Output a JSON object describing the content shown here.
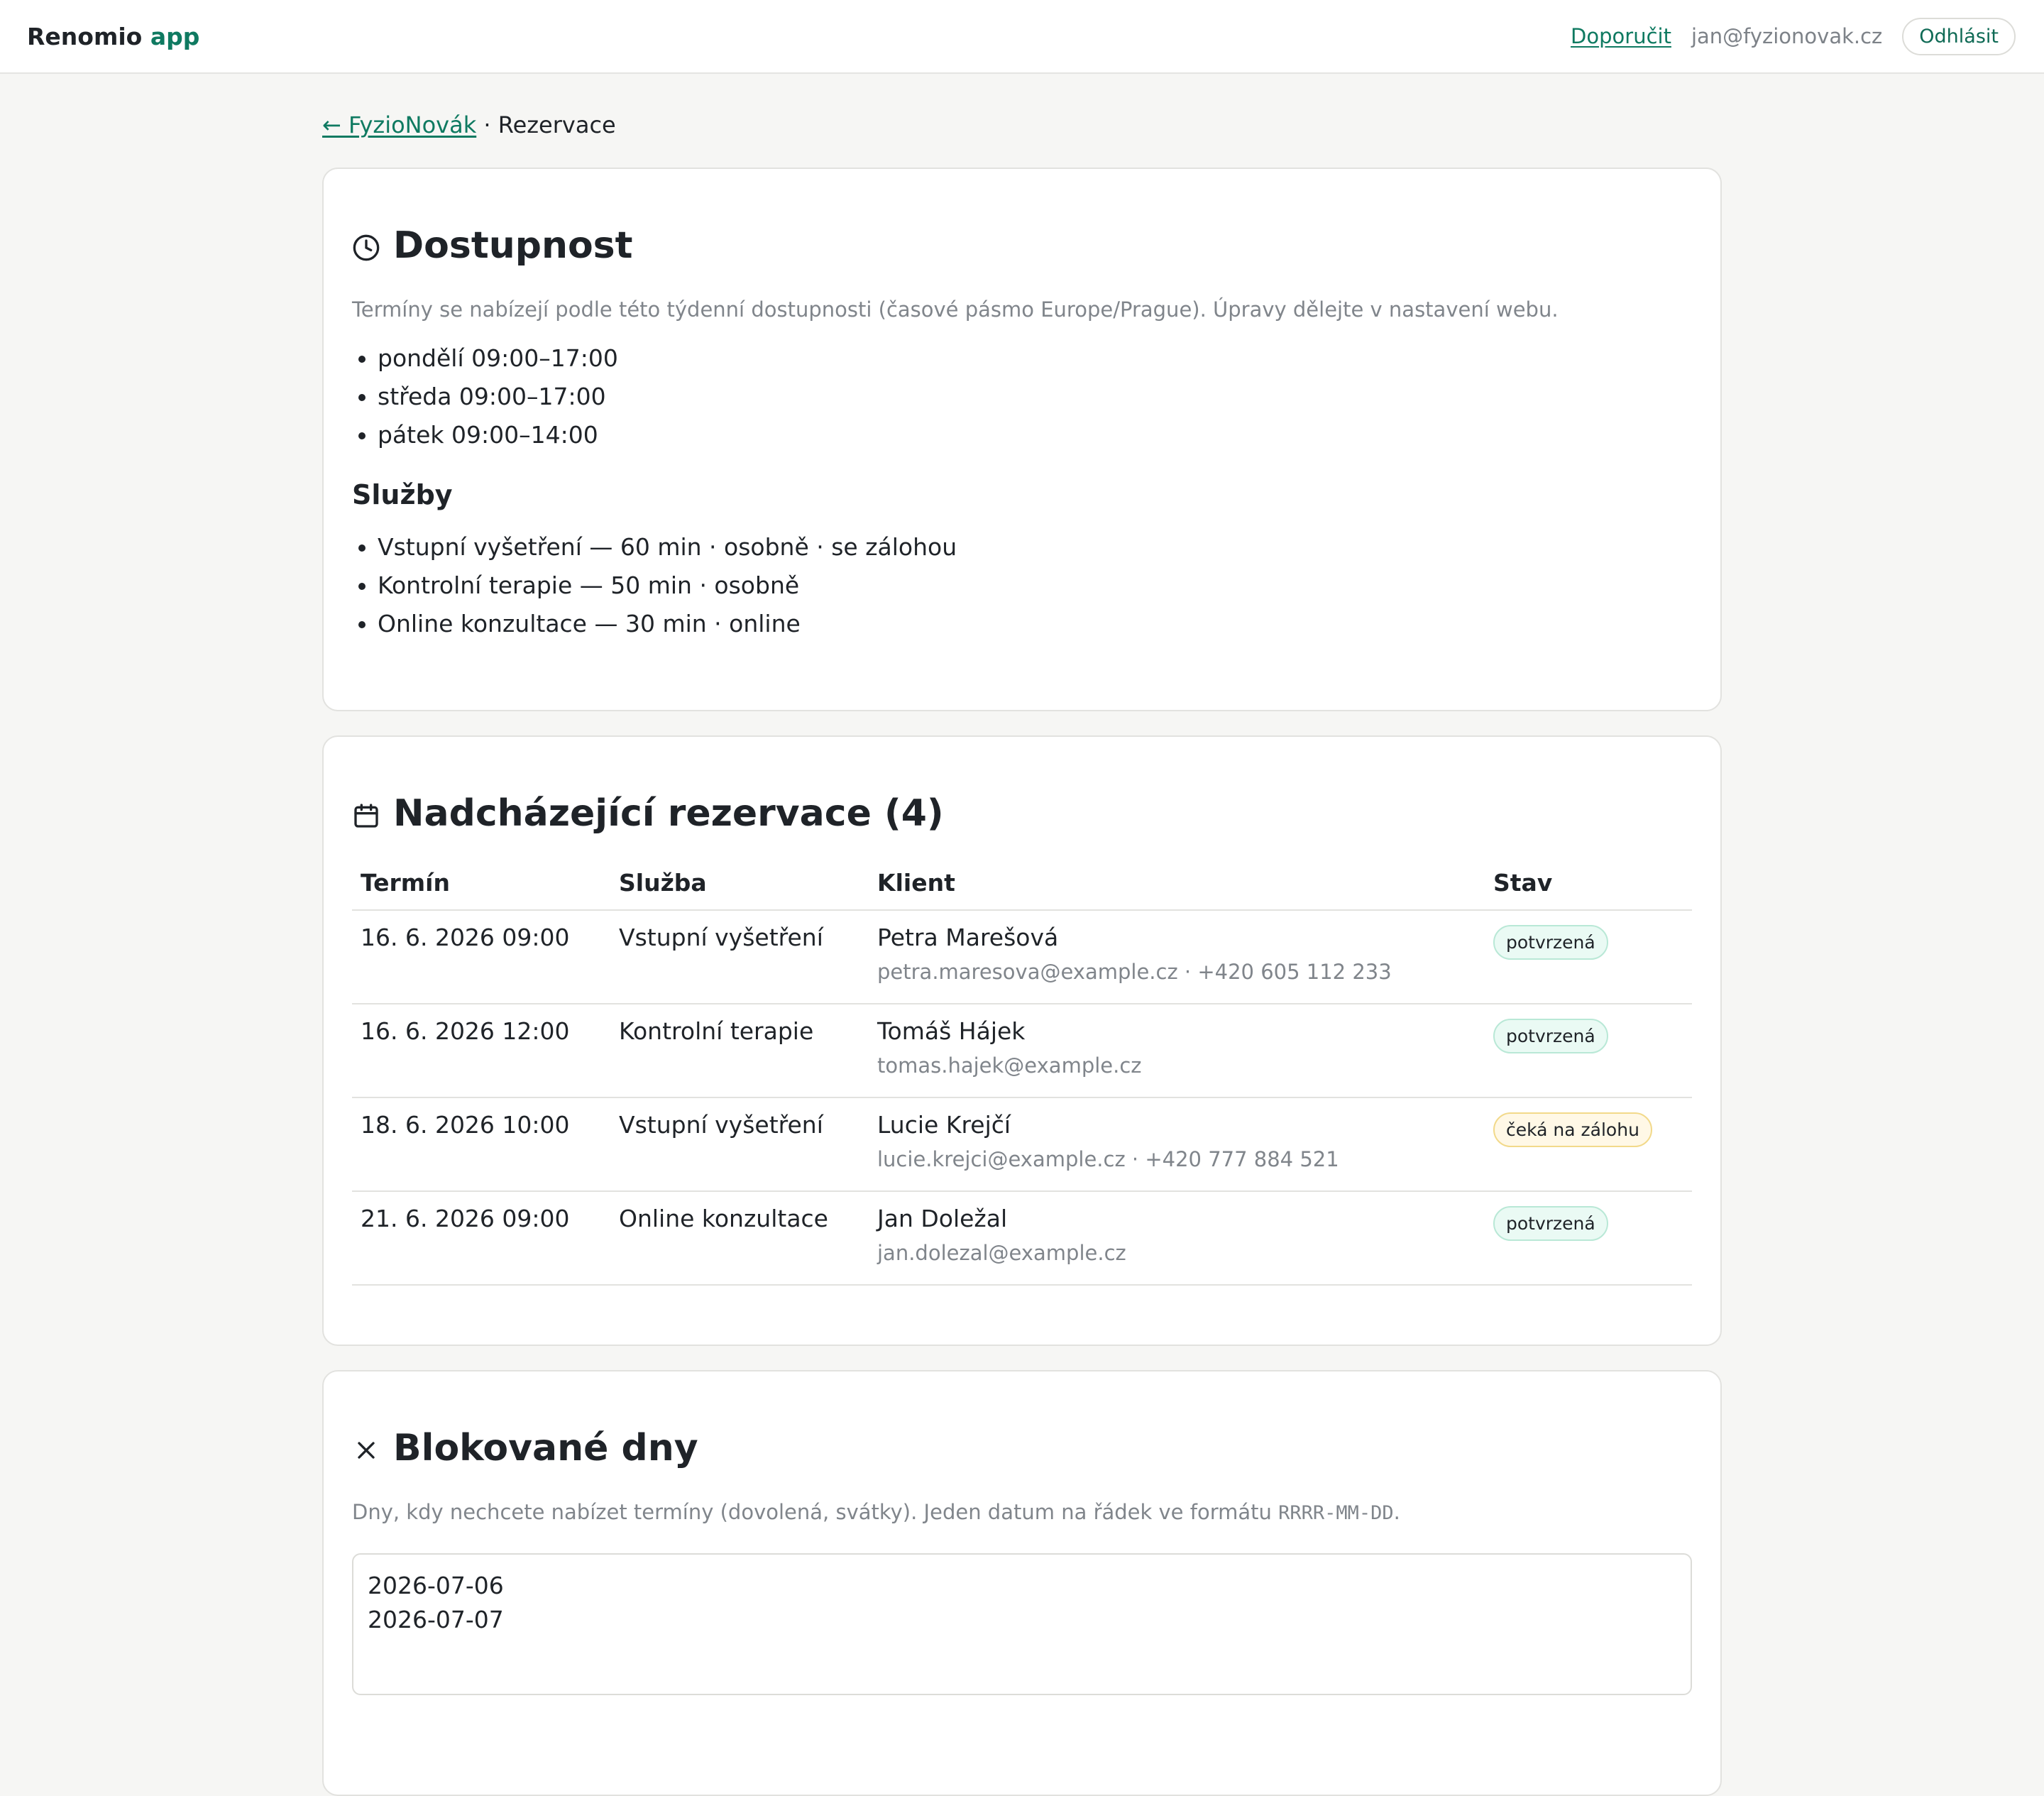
{
  "header": {
    "brand_name": "Renomio",
    "brand_accent": "app",
    "recommend_label": "Doporučit",
    "user_email": "jan@fyzionovak.cz",
    "logout_label": "Odhlásit"
  },
  "breadcrumb": {
    "back_label": "← FyzioNovák",
    "separator": "·",
    "current": "Rezervace"
  },
  "availability": {
    "title": "Dostupnost",
    "hint": "Termíny se nabízejí podle této týdenní dostupnosti (časové pásmo Europe/Prague). Úpravy dělejte v nastavení webu.",
    "items": [
      "pondělí 09:00–17:00",
      "středa 09:00–17:00",
      "pátek 09:00–14:00"
    ],
    "services_title": "Služby",
    "services": [
      "Vstupní vyšetření — 60 min · osobně · se zálohou",
      "Kontrolní terapie — 50 min · osobně",
      "Online konzultace — 30 min · online"
    ]
  },
  "reservations": {
    "title": "Nadcházející rezervace (4)",
    "columns": [
      "Termín",
      "Služba",
      "Klient",
      "Stav"
    ],
    "rows": [
      {
        "date": "16. 6. 2026 09:00",
        "service": "Vstupní vyšetření",
        "client": "Petra Marešová",
        "contact": "petra.maresova@example.cz · +420 605 112 233",
        "status": "potvrzená",
        "status_kind": "ok"
      },
      {
        "date": "16. 6. 2026 12:00",
        "service": "Kontrolní terapie",
        "client": "Tomáš Hájek",
        "contact": "tomas.hajek@example.cz",
        "status": "potvrzená",
        "status_kind": "ok"
      },
      {
        "date": "18. 6. 2026 10:00",
        "service": "Vstupní vyšetření",
        "client": "Lucie Krejčí",
        "contact": "lucie.krejci@example.cz · +420 777 884 521",
        "status": "čeká na zálohu",
        "status_kind": "wait"
      },
      {
        "date": "21. 6. 2026 09:00",
        "service": "Online konzultace",
        "client": "Jan Doležal",
        "contact": "jan.dolezal@example.cz",
        "status": "potvrzená",
        "status_kind": "ok"
      }
    ]
  },
  "blocked": {
    "title": "Blokované dny",
    "hint_pre": "Dny, kdy nechcete nabízet termíny (dovolená, svátky). Jeden datum na řádek ve formátu ",
    "hint_code": "RRRR-MM-DD",
    "hint_post": ".",
    "value": "2026-07-06\n2026-07-07"
  },
  "colors": {
    "accent": "#0f7a61",
    "badge_ok_bg": "#eafaf4",
    "badge_wait_bg": "#fff8e6"
  },
  "icons": {
    "availability": "clock-icon",
    "reservations": "calendar-icon",
    "blocked": "close-icon"
  }
}
